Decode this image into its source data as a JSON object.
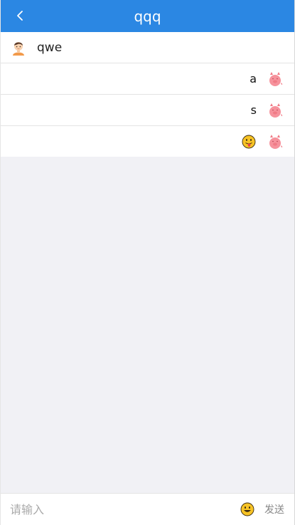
{
  "header": {
    "title": "qqq",
    "back_icon": "chevron-left-icon"
  },
  "messages": [
    {
      "side": "left",
      "text": "qwe",
      "avatar": "boy-avatar"
    },
    {
      "side": "right",
      "text": "a",
      "avatar": "pig-avatar"
    },
    {
      "side": "right",
      "text": "s",
      "avatar": "pig-avatar"
    },
    {
      "side": "right",
      "text": "",
      "emoji": "tongue-out-emoji",
      "avatar": "pig-avatar"
    }
  ],
  "input": {
    "placeholder": "请输入",
    "value": "",
    "emoji_icon": "smiley-icon",
    "send_label": "发送"
  },
  "colors": {
    "header_bg": "#2b87e3",
    "page_bg": "#f1f1f5"
  }
}
